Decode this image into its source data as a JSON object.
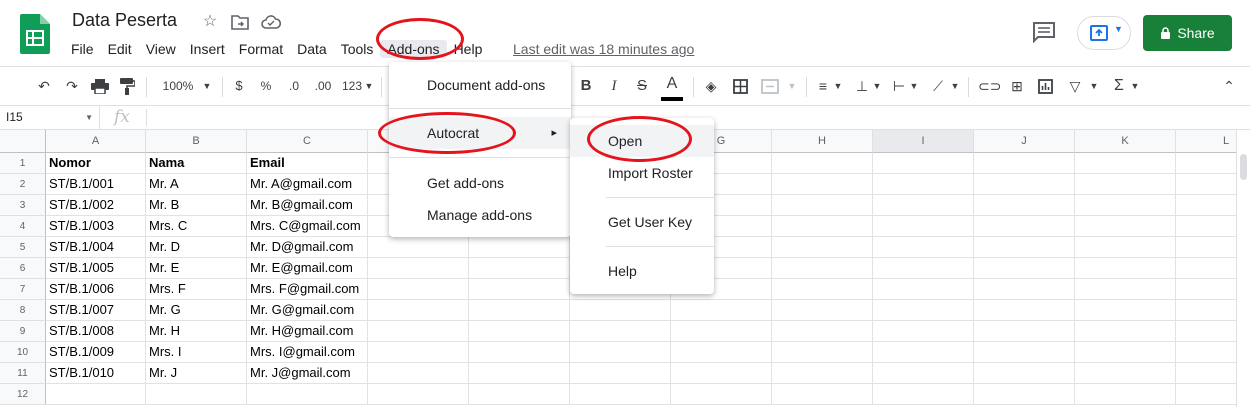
{
  "app": {
    "doc_title": "Data Peserta",
    "last_edit": "Last edit was 18 minutes ago",
    "share_label": "Share",
    "accent_color": "#188038"
  },
  "menubar": [
    "File",
    "Edit",
    "View",
    "Insert",
    "Format",
    "Data",
    "Tools",
    "Add-ons",
    "Help"
  ],
  "toolbar": {
    "zoom": "100%",
    "currency": "$",
    "percent": "%",
    "decrease_decimal": ".0",
    "increase_decimal": ".00",
    "format_more": "123",
    "bold": "B",
    "italic": "I",
    "strike": "S",
    "text_color": "A",
    "icons": [
      "undo-icon",
      "redo-icon",
      "print-icon",
      "paint-format-icon",
      "fill-color-icon",
      "borders-icon",
      "merge-icon",
      "align-icon",
      "valign-icon",
      "wrap-icon",
      "rotate-icon",
      "link-icon",
      "comment-icon",
      "chart-icon",
      "filter-icon",
      "functions-icon",
      "collapse-icon"
    ]
  },
  "formula_bar": {
    "name_box": "I15",
    "fx": "fx"
  },
  "grid": {
    "columns": [
      "A",
      "B",
      "C",
      "D",
      "E",
      "F",
      "G",
      "H",
      "I",
      "J",
      "K",
      "L"
    ],
    "selected_column": "I",
    "row_numbers": [
      "1",
      "2",
      "3",
      "4",
      "5",
      "6",
      "7",
      "8",
      "9",
      "10",
      "11",
      "12"
    ],
    "rows": [
      [
        "Nomor",
        "Nama",
        "Email"
      ],
      [
        "ST/B.1/001",
        "Mr. A",
        "Mr. A@gmail.com"
      ],
      [
        "ST/B.1/002",
        "Mr. B",
        "Mr. B@gmail.com"
      ],
      [
        "ST/B.1/003",
        "Mrs. C",
        "Mrs. C@gmail.com"
      ],
      [
        "ST/B.1/004",
        "Mr. D",
        "Mr. D@gmail.com"
      ],
      [
        "ST/B.1/005",
        "Mr. E",
        "Mr. E@gmail.com"
      ],
      [
        "ST/B.1/006",
        "Mrs. F",
        "Mrs. F@gmail.com"
      ],
      [
        "ST/B.1/007",
        "Mr. G",
        "Mr. G@gmail.com"
      ],
      [
        "ST/B.1/008",
        "Mr. H",
        "Mr. H@gmail.com"
      ],
      [
        "ST/B.1/009",
        "Mrs. I",
        "Mrs. I@gmail.com"
      ],
      [
        "ST/B.1/010",
        "Mr. J",
        "Mr. J@gmail.com"
      ]
    ]
  },
  "addons_menu": {
    "items": [
      "Document add-ons",
      "Autocrat",
      "Get add-ons",
      "Manage add-ons"
    ],
    "submenu_arrow": "▸"
  },
  "autocrat_menu": {
    "items": [
      "Open",
      "Import Roster",
      "Get User Key",
      "Help"
    ]
  },
  "annotation_color": "#e4131c"
}
